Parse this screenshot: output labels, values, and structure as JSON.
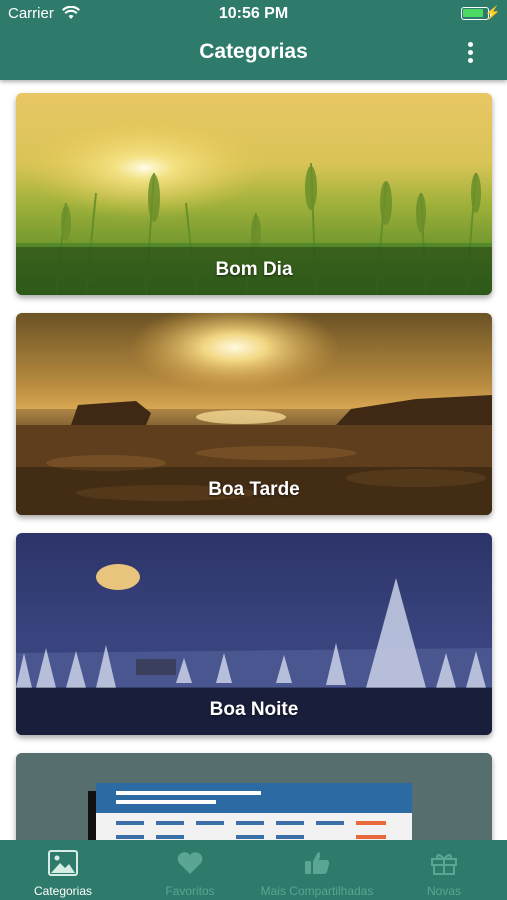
{
  "status_bar": {
    "carrier": "Carrier",
    "time": "10:56 PM"
  },
  "header": {
    "title": "Categorias"
  },
  "cards": [
    {
      "label": "Bom Dia"
    },
    {
      "label": "Boa Tarde"
    },
    {
      "label": "Boa Noite"
    }
  ],
  "tabs": [
    {
      "label": "Categorias",
      "icon": "image-icon",
      "active": true
    },
    {
      "label": "Favoritos",
      "icon": "heart-icon",
      "active": false
    },
    {
      "label": "Mais Compartilhadas",
      "icon": "thumbs-up-icon",
      "active": false
    },
    {
      "label": "Novas",
      "icon": "gift-icon",
      "active": false
    }
  ],
  "colors": {
    "primary": "#2f7b6b",
    "tab_inactive": "#5aa594",
    "tab_active": "#ffffff"
  }
}
